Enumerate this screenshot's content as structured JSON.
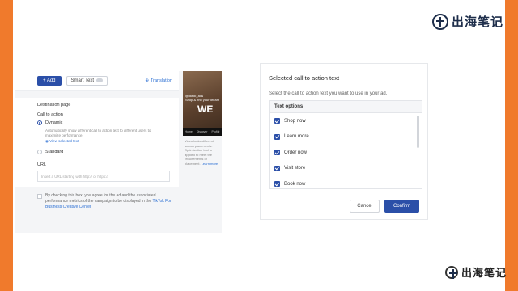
{
  "brand": {
    "name": "出海笔记"
  },
  "left_screenshot": {
    "toolbar": {
      "add_label": "+ Add",
      "smart_text_label": "Smart Text",
      "translation_label": "Translation"
    },
    "destination_page_label": "Destination page",
    "call_to_action_label": "Call to action",
    "dynamic_label": "Dynamic",
    "dynamic_help": "Automatically show different call to action text to different users to maximize performance.",
    "view_selected_text": "View selected text",
    "standard_label": "Standard",
    "url_label": "URL",
    "url_placeholder": "Insert a URL starting with http:// or https://",
    "consent_text": "By checking this box, you agree for the ad and the associated performance metrics of the campaign to be displayed in the",
    "consent_link": "TikTok For Business Creative Center",
    "preview": {
      "caption_line1": "@tiktok_ads",
      "caption_line2": "Shop & find your dream",
      "big_text": "WE",
      "nav_home": "Home",
      "nav_discover": "Discover",
      "nav_profile": "Profile",
      "note": "Video looks different across placements. Optimization tool is applied to meet the requirements of placement.",
      "learn_more": "Learn more"
    }
  },
  "modal": {
    "title": "Selected call to action text",
    "subtitle": "Select the call to action text you want to use in your ad.",
    "options_header": "Text options",
    "options": [
      {
        "label": "Shop now",
        "checked": true
      },
      {
        "label": "Learn more",
        "checked": true
      },
      {
        "label": "Order now",
        "checked": true
      },
      {
        "label": "Visit store",
        "checked": true
      },
      {
        "label": "Book now",
        "checked": true
      }
    ],
    "cancel_label": "Cancel",
    "confirm_label": "Confirm"
  },
  "colors": {
    "frame": "#f07a2c",
    "primary": "#2b4fa8",
    "link": "#2b6fd3"
  }
}
